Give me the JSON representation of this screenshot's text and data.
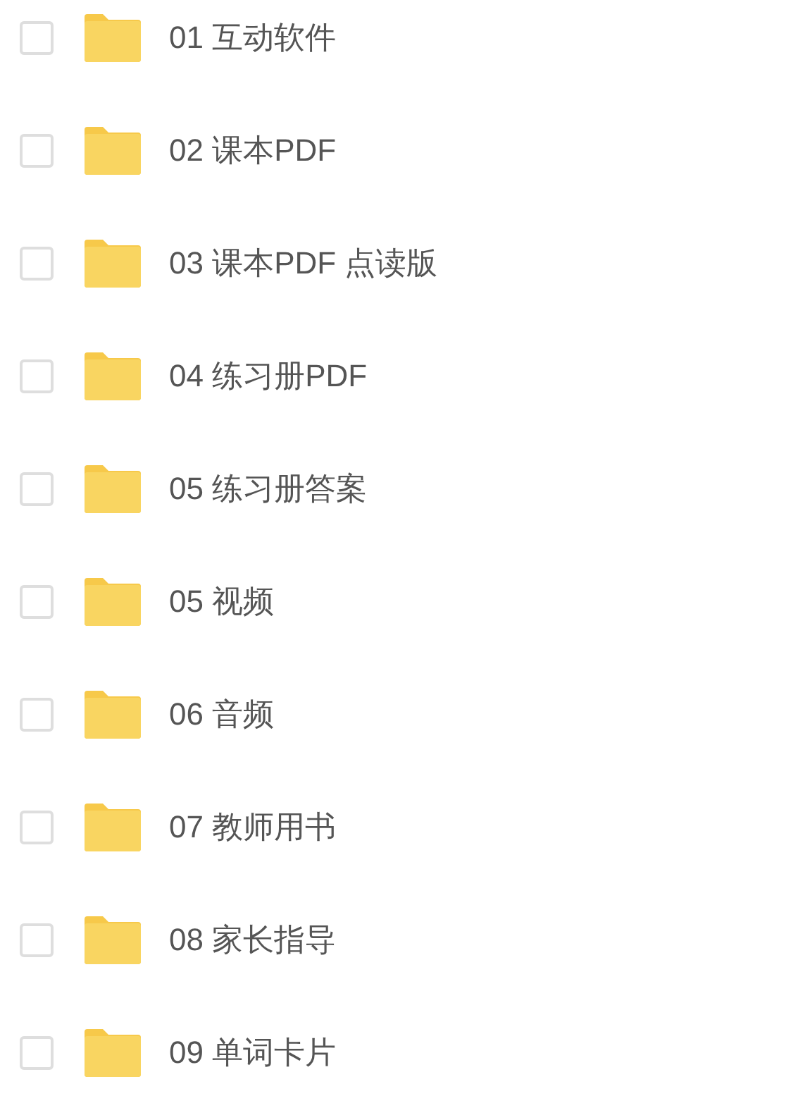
{
  "folders": [
    {
      "name": "01 互动软件",
      "checked": false
    },
    {
      "name": "02 课本PDF",
      "checked": false
    },
    {
      "name": "03 课本PDF 点读版",
      "checked": false
    },
    {
      "name": "04 练习册PDF",
      "checked": false
    },
    {
      "name": "05 练习册答案",
      "checked": false
    },
    {
      "name": "05 视频",
      "checked": false
    },
    {
      "name": "06 音频",
      "checked": false
    },
    {
      "name": "07 教师用书",
      "checked": false
    },
    {
      "name": "08 家长指导",
      "checked": false
    },
    {
      "name": "09 单词卡片",
      "checked": false
    }
  ]
}
